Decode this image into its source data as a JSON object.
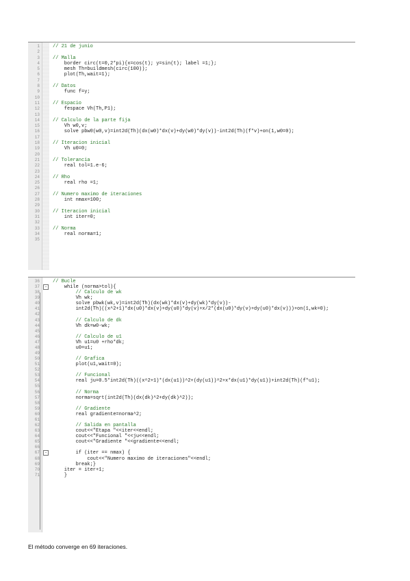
{
  "panel1": {
    "lines": [
      {
        "n": "1",
        "t": "// 21 de junio",
        "c": "comment"
      },
      {
        "n": "2",
        "t": "",
        "c": ""
      },
      {
        "n": "3",
        "t": "// Malla",
        "c": "comment"
      },
      {
        "n": "4",
        "t": "    border circ(t=0,2*pi){x=cos(t); y=sin(t); label =1;};",
        "c": ""
      },
      {
        "n": "5",
        "t": "    mesh Th=buildmesh(circ(100));",
        "c": ""
      },
      {
        "n": "6",
        "t": "    plot(Th,wait=1);",
        "c": ""
      },
      {
        "n": "7",
        "t": "",
        "c": ""
      },
      {
        "n": "8",
        "t": "// Datos",
        "c": "comment"
      },
      {
        "n": "9",
        "t": "    func f=y;",
        "c": ""
      },
      {
        "n": "10",
        "t": "",
        "c": ""
      },
      {
        "n": "11",
        "t": "// Espacio",
        "c": "comment"
      },
      {
        "n": "12",
        "t": "    fespace Vh(Th,P1);",
        "c": ""
      },
      {
        "n": "13",
        "t": "",
        "c": ""
      },
      {
        "n": "14",
        "t": "// Calculo de la parte fija",
        "c": "comment"
      },
      {
        "n": "15",
        "t": "    Vh w0,v;",
        "c": ""
      },
      {
        "n": "16",
        "t": "    solve pbw0(w0,v)=int2d(Th)(dx(w0)*dx(v)+dy(w0)*dy(v))-int2d(Th)(f*v)+on(1,w0=0);",
        "c": ""
      },
      {
        "n": "17",
        "t": "",
        "c": ""
      },
      {
        "n": "18",
        "t": "// Iteracion inicial",
        "c": "comment"
      },
      {
        "n": "19",
        "t": "    Vh u0=0;",
        "c": ""
      },
      {
        "n": "20",
        "t": "",
        "c": ""
      },
      {
        "n": "21",
        "t": "// Tolerancia",
        "c": "comment"
      },
      {
        "n": "22",
        "t": "    real tol=1.e-6;",
        "c": ""
      },
      {
        "n": "23",
        "t": "",
        "c": ""
      },
      {
        "n": "24",
        "t": "// Rho",
        "c": "comment"
      },
      {
        "n": "25",
        "t": "    real rho =1;",
        "c": ""
      },
      {
        "n": "26",
        "t": "",
        "c": ""
      },
      {
        "n": "27",
        "t": "// Numero maximo de iteraciones",
        "c": "comment"
      },
      {
        "n": "28",
        "t": "    int nmax=100;",
        "c": ""
      },
      {
        "n": "29",
        "t": "",
        "c": ""
      },
      {
        "n": "30",
        "t": "// Iteracion inicial",
        "c": "comment"
      },
      {
        "n": "31",
        "t": "    int iter=0;",
        "c": ""
      },
      {
        "n": "32",
        "t": "",
        "c": ""
      },
      {
        "n": "33",
        "t": "// Norma",
        "c": "comment"
      },
      {
        "n": "34",
        "t": "    real norma=1;",
        "c": ""
      },
      {
        "n": "35",
        "t": "",
        "c": ""
      }
    ]
  },
  "panel2": {
    "lines": [
      {
        "n": "36",
        "t": "// Bucle",
        "c": "comment"
      },
      {
        "n": "37",
        "t": "    while (norma>tol){",
        "c": "",
        "fold": "-"
      },
      {
        "n": "38",
        "t": "        // Calculo de wk",
        "c": "comment"
      },
      {
        "n": "39",
        "t": "        Vh wk;",
        "c": ""
      },
      {
        "n": "40",
        "t": "        solve pbwk(wk,v)=int2d(Th)(dx(wk)*dx(v)+dy(wk)*dy(v))-",
        "c": ""
      },
      {
        "n": "41",
        "t": "        int2d(Th)((x^2+1)*dx(u0)*dx(v)+dy(u0)*dy(v)+x/2*(dx(u0)*dy(v)+dy(u0)*dx(v)))+on(1,wk=0);",
        "c": ""
      },
      {
        "n": "42",
        "t": "",
        "c": ""
      },
      {
        "n": "43",
        "t": "        // Calculo de dk",
        "c": "comment"
      },
      {
        "n": "44",
        "t": "        Vh dk=w0-wk;",
        "c": ""
      },
      {
        "n": "45",
        "t": "",
        "c": ""
      },
      {
        "n": "46",
        "t": "        // Calculo de u1",
        "c": "comment"
      },
      {
        "n": "47",
        "t": "        Vh u1=u0 +rho*dk;",
        "c": ""
      },
      {
        "n": "48",
        "t": "        u0=u1;",
        "c": ""
      },
      {
        "n": "49",
        "t": "",
        "c": ""
      },
      {
        "n": "50",
        "t": "        // Grafica",
        "c": "comment"
      },
      {
        "n": "51",
        "t": "        plot(u1,wait=0);",
        "c": ""
      },
      {
        "n": "52",
        "t": "",
        "c": ""
      },
      {
        "n": "53",
        "t": "        // Funcional",
        "c": "comment"
      },
      {
        "n": "54",
        "t": "        real ju=0.5*int2d(Th)((x^2+1)*(dx(u1))^2+(dy(u1))^2+x*dx(u1)*dy(u1))+int2d(Th)(f*u1);",
        "c": ""
      },
      {
        "n": "55",
        "t": "",
        "c": ""
      },
      {
        "n": "56",
        "t": "        // Norma",
        "c": "comment"
      },
      {
        "n": "57",
        "t": "        norma=sqrt(int2d(Th)(dx(dk)^2+dy(dk)^2));",
        "c": ""
      },
      {
        "n": "58",
        "t": "",
        "c": ""
      },
      {
        "n": "59",
        "t": "        // Gradiente",
        "c": "comment"
      },
      {
        "n": "60",
        "t": "        real gradiente=norma^2;",
        "c": ""
      },
      {
        "n": "61",
        "t": "",
        "c": ""
      },
      {
        "n": "62",
        "t": "        // Salida en pantalla",
        "c": "comment"
      },
      {
        "n": "63",
        "t": "        cout<<\"Etapa \"<<iter<<endl;",
        "c": ""
      },
      {
        "n": "64",
        "t": "        cout<<\"Funcional \"<<ju<<endl;",
        "c": ""
      },
      {
        "n": "65",
        "t": "        cout<<\"Gradiente \"<<gradiente<<endl;",
        "c": ""
      },
      {
        "n": "66",
        "t": "",
        "c": ""
      },
      {
        "n": "67",
        "t": "        if (iter == nmax) {",
        "c": "",
        "fold": "-"
      },
      {
        "n": "68",
        "t": "            cout<<\"Numero maximo de iteraciones\"<<endl;",
        "c": ""
      },
      {
        "n": "69",
        "t": "        break;}",
        "c": ""
      },
      {
        "n": "70",
        "t": "    iter = iter+1;",
        "c": ""
      },
      {
        "n": "71",
        "t": "    }",
        "c": ""
      }
    ]
  },
  "caption": "El método converge en 69 iteraciones."
}
